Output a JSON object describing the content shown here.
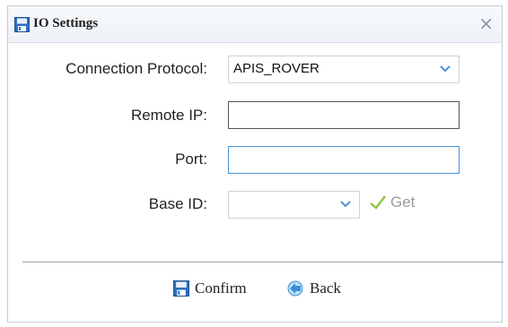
{
  "dialog": {
    "title": "IO Settings",
    "close_glyph": "×"
  },
  "form": {
    "protocol_label": "Connection Protocol:",
    "protocol_value": "APIS_ROVER",
    "remote_ip_label": "Remote IP:",
    "remote_ip_value": "",
    "port_label": "Port:",
    "port_value": "",
    "base_id_label": "Base ID:",
    "base_id_value": "",
    "get_label": "Get"
  },
  "footer": {
    "confirm_label": "Confirm",
    "back_label": "Back"
  },
  "icons": {
    "title": "floppy-disk-icon",
    "close": "close-icon",
    "get": "checkmark-icon",
    "confirm": "floppy-disk-icon",
    "back": "back-arrow-icon"
  },
  "colors": {
    "accent_blue": "#4a90d9",
    "check_green": "#8cc63f"
  }
}
